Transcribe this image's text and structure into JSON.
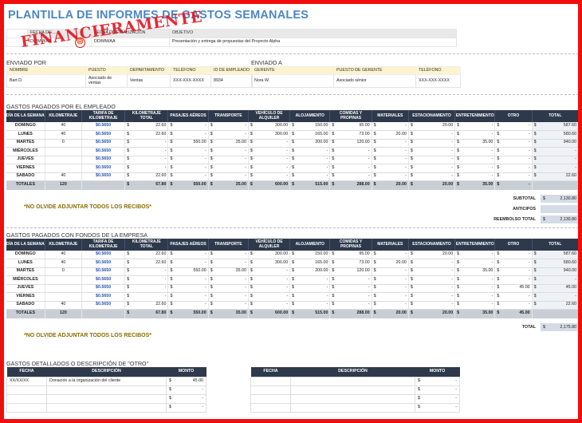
{
  "title": "PLANTILLA DE INFORMES DE GASTOS SEMANALES",
  "header": {
    "labels": [
      "FECHA DE ...",
      "FECHA DE FINALIZACIÓN",
      "OBJETIVO"
    ],
    "values": [
      "DD/MM/AA",
      "DD/MM/AA",
      "Presentación y entrega de propuestas del Proyecto Alpha"
    ]
  },
  "sent_by": {
    "label": "ENVIADO POR",
    "columns": [
      "NOMBRE",
      "PUESTO",
      "DEPARTAMENTO",
      "TELÉFONO",
      "ID DE EMPLEADO"
    ],
    "values": [
      "Bart D.",
      "Asociado de ventas",
      "Ventas",
      "XXX-XXX-XXXX",
      "8934"
    ]
  },
  "sent_to": {
    "label": "ENVIADO A",
    "columns": [
      "GERENTE",
      "PUESTO DE GERENTE",
      "TELÉFONO"
    ],
    "values": [
      "Nora W.",
      "Asociado sénior",
      "XXX-XXX-XXXX"
    ]
  },
  "columns": [
    "DÍA DE LA SEMANA",
    "KILOMETRAJE",
    "TARIFA DE KILOMETRAJE",
    "KILOMETRAJE TOTAL",
    "PASAJES AÉREOS",
    "TRANSPORTE",
    "VEHÍCULO DE ALQUILER",
    "ALOJAMIENTO",
    "COMIDAS Y PROPINAS",
    "MATERIALES",
    "ESTACIONAMIENTO",
    "ENTRETENIMIENTO",
    "OTRO",
    "TOTAL"
  ],
  "currency": "$",
  "dash": "-",
  "employee": {
    "section": "GASTOS PAGADOS POR EL EMPLEADO",
    "rows": [
      [
        "DOMINGO",
        "40",
        "$0.5650",
        "22.60",
        "-",
        "-",
        "300.00",
        "150.00",
        "95.00",
        "-",
        "20.00",
        "-",
        "-",
        "587.60"
      ],
      [
        "LUNES",
        "40",
        "$0.5650",
        "22.60",
        "-",
        "-",
        "300.00",
        "165.00",
        "73.00",
        "20.00",
        "-",
        "-",
        "-",
        "580.60"
      ],
      [
        "MARTES",
        "0",
        "$0.5650",
        "-",
        "550.00",
        "35.00",
        "-",
        "200.00",
        "120.00",
        "-",
        "-",
        "35.00",
        "-",
        "940.00"
      ],
      [
        "MIÉRCOLES",
        "",
        "$0.5650",
        "-",
        "-",
        "-",
        "-",
        "-",
        "-",
        "-",
        "-",
        "-",
        "-",
        "-"
      ],
      [
        "JUEVES",
        "",
        "$0.5650",
        "-",
        "-",
        "-",
        "-",
        "-",
        "-",
        "-",
        "-",
        "-",
        "-",
        "-"
      ],
      [
        "VIERNES",
        "",
        "$0.5650",
        "-",
        "-",
        "-",
        "-",
        "-",
        "-",
        "-",
        "-",
        "-",
        "-",
        "-"
      ],
      [
        "SÁBADO",
        "40",
        "$0.5650",
        "22.60",
        "-",
        "-",
        "-",
        "-",
        "-",
        "-",
        "-",
        "-",
        "-",
        "22.60"
      ]
    ],
    "totals": [
      "TOTALES",
      "120",
      "",
      "67.80",
      "550.00",
      "35.00",
      "600.00",
      "515.00",
      "288.00",
      "20.00",
      "20.00",
      "35.00",
      "-",
      ""
    ],
    "reminder": "*NO OLVIDE ADJUNTAR TODOS LOS RECIBOS*",
    "summary": [
      {
        "label": "SUBTOTAL",
        "value": "2,130.80"
      },
      {
        "label": "ANTICIPOS",
        "value": ""
      },
      {
        "label": "REEMBOLSO TOTAL",
        "value": "2,130.80"
      }
    ]
  },
  "company": {
    "section": "GASTOS PAGADOS CON FONDOS DE LA EMPRESA",
    "rows": [
      [
        "DOMINGO",
        "40",
        "$0.5650",
        "22.60",
        "-",
        "-",
        "300.00",
        "150.00",
        "95.00",
        "-",
        "20.00",
        "-",
        "-",
        "587.60"
      ],
      [
        "LUNES",
        "40",
        "$0.5650",
        "22.60",
        "-",
        "-",
        "300.00",
        "165.00",
        "73.00",
        "20.00",
        "-",
        "-",
        "-",
        "580.60"
      ],
      [
        "MARTES",
        "0",
        "$0.5650",
        "-",
        "550.00",
        "35.00",
        "-",
        "200.00",
        "120.00",
        "-",
        "-",
        "35.00",
        "-",
        "940.00"
      ],
      [
        "MIÉRCOLES",
        "",
        "$0.5650",
        "-",
        "-",
        "-",
        "-",
        "-",
        "-",
        "-",
        "-",
        "-",
        "-",
        "-"
      ],
      [
        "JUEVES",
        "",
        "$0.5650",
        "-",
        "-",
        "-",
        "-",
        "-",
        "-",
        "-",
        "-",
        "-",
        "45.00",
        "45.00"
      ],
      [
        "VIERNES",
        "",
        "$0.5650",
        "-",
        "-",
        "-",
        "-",
        "-",
        "-",
        "-",
        "-",
        "-",
        "-",
        "-"
      ],
      [
        "SÁBADO",
        "40",
        "$0.5650",
        "22.60",
        "-",
        "-",
        "-",
        "-",
        "-",
        "-",
        "-",
        "-",
        "-",
        "22.60"
      ]
    ],
    "totals": [
      "TOTALES",
      "120",
      "",
      "67.80",
      "550.00",
      "35.00",
      "600.00",
      "515.00",
      "288.00",
      "20.00",
      "20.00",
      "35.00",
      "45.00",
      ""
    ],
    "reminder": "*NO OLVIDE ADJUNTAR TODOS LOS RECIBOS*",
    "summary": [
      {
        "label": "TOTAL",
        "value": "2,175.80"
      }
    ]
  },
  "details": {
    "section": "GASTOS DETALLADOS O DESCRIPCIÓN DE \"OTRO\"",
    "columns": [
      "FECHA",
      "DESCRIPCIÓN",
      "MONTO"
    ],
    "left_rows": [
      [
        "XX/XX/XX",
        "Donación a la organización del cliente",
        "45.00"
      ],
      [
        "",
        "",
        "-"
      ],
      [
        "",
        "",
        "-"
      ],
      [
        "",
        "",
        "-"
      ]
    ],
    "right_rows": [
      [
        "",
        "",
        "-"
      ],
      [
        "",
        "",
        "-"
      ],
      [
        "",
        "",
        "-"
      ],
      [
        "",
        "",
        "-"
      ]
    ]
  },
  "watermark": "FINANCIERAMENTE"
}
